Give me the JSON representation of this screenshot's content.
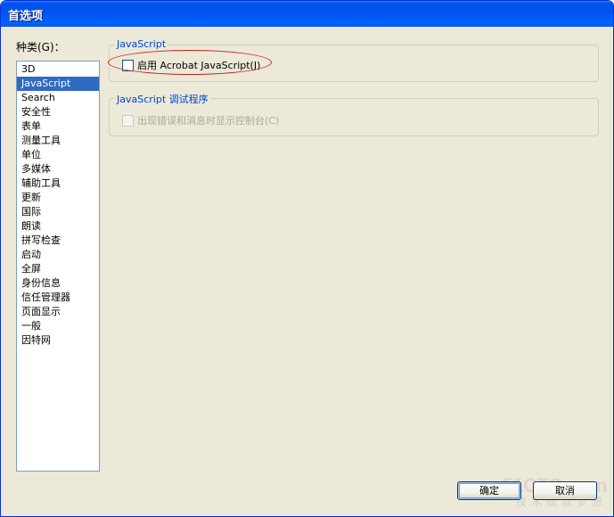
{
  "window": {
    "title": "首选项"
  },
  "categories": {
    "label": "种类(G)：",
    "items": [
      "3D",
      "JavaScript",
      "Search",
      "安全性",
      "表单",
      "测量工具",
      "单位",
      "多媒体",
      "辅助工具",
      "更新",
      "国际",
      "朗读",
      "拼写检查",
      "启动",
      "全屏",
      "身份信息",
      "信任管理器",
      "页面显示",
      "一般",
      "因特网"
    ],
    "selected": "JavaScript"
  },
  "javascript_group": {
    "legend": "JavaScript",
    "enable_js": {
      "label": "启用 Acrobat JavaScript(J)",
      "checked": false
    }
  },
  "debug_group": {
    "legend": "JavaScript 调试程序",
    "show_console": {
      "label": "出现错误和消息时显示控制台(C)",
      "checked": false,
      "enabled": false
    }
  },
  "buttons": {
    "ok": "确定",
    "cancel": "取消"
  },
  "watermark": {
    "brand": "51CTO.com",
    "slogan": "技术成就梦想"
  },
  "colors": {
    "titlebar": "#0054e3",
    "selection": "#316ac5",
    "legend_text": "#0046d5",
    "highlight_ellipse": "#cc1f1f"
  }
}
